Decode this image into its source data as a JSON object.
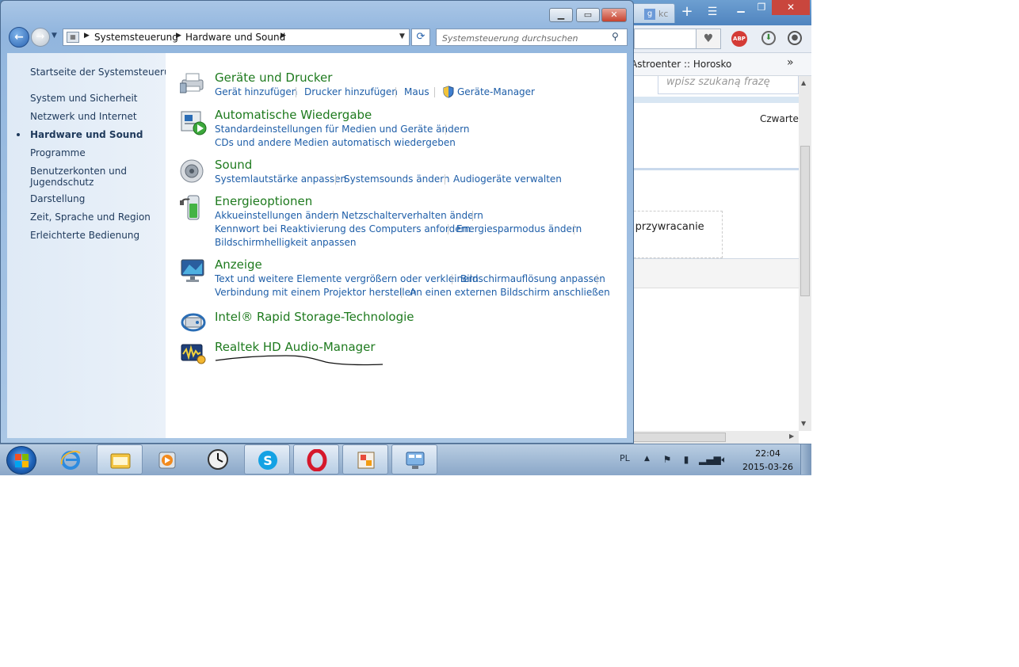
{
  "browser": {
    "tab_label": "kc",
    "new_tab": "+",
    "bookmark": "Astroenter :: Horosko",
    "search_placeholder": "wpisz szukaną frazę",
    "weekday": "Czwartek",
    "restore_text": "k przywracanie",
    "abp_label": "ABP"
  },
  "window": {
    "address_crumbs": [
      "Systemsteuerung",
      "Hardware und Sound"
    ],
    "search_placeholder": "Systemsteuerung durchsuchen"
  },
  "sidebar": {
    "items": [
      {
        "label": "Startseite der Systemsteuerung"
      },
      {
        "label": "System und Sicherheit"
      },
      {
        "label": "Netzwerk und Internet"
      },
      {
        "label": "Hardware und Sound",
        "selected": true
      },
      {
        "label": "Programme"
      },
      {
        "label": "Benutzerkonten und"
      },
      {
        "label": "Jugendschutz"
      },
      {
        "label": "Darstellung"
      },
      {
        "label": "Zeit, Sprache und Region"
      },
      {
        "label": "Erleichterte Bedienung"
      }
    ]
  },
  "categories": [
    {
      "title": "Geräte und Drucker",
      "icon": "printer-icon",
      "links": [
        "Gerät hinzufügen",
        "Drucker hinzufügen",
        "Maus",
        "Geräte-Manager"
      ]
    },
    {
      "title": "Automatische Wiedergabe",
      "icon": "autoplay-icon",
      "links": [
        "Standardeinstellungen für Medien und Geräte ändern",
        "CDs und andere Medien automatisch wiedergeben"
      ]
    },
    {
      "title": "Sound",
      "icon": "speaker-icon",
      "links": [
        "Systemlautstärke anpassen",
        "Systemsounds ändern",
        "Audiogeräte verwalten"
      ]
    },
    {
      "title": "Energieoptionen",
      "icon": "battery-icon",
      "links": [
        "Akkueinstellungen ändern",
        "Netzschalterverhalten ändern",
        "Kennwort bei Reaktivierung des Computers anfordern",
        "Energiesparmodus ändern",
        "Bildschirmhelligkeit anpassen"
      ]
    },
    {
      "title": "Anzeige",
      "icon": "monitor-icon",
      "links": [
        "Text und weitere Elemente vergrößern oder verkleinern",
        "Bildschirmauflösung anpassen",
        "Verbindung mit einem Projektor herstellen",
        "An einen externen Bildschirm anschließen"
      ]
    },
    {
      "title": "Intel® Rapid Storage-Technologie",
      "icon": "intel-storage-icon",
      "links": []
    },
    {
      "title": "Realtek HD Audio-Manager",
      "icon": "realtek-audio-icon",
      "links": []
    }
  ],
  "taskbar": {
    "apps": [
      "internet-explorer",
      "windows-explorer",
      "media-player",
      "clock",
      "skype",
      "opera",
      "paint-app",
      "control-panel"
    ],
    "active_apps": [
      "windows-explorer",
      "skype",
      "opera",
      "paint-app",
      "control-panel"
    ],
    "language": "PL",
    "time": "22:04",
    "date": "2015-03-26"
  },
  "colors": {
    "category_title": "#1e7a1e",
    "task_link": "#1e5ea8",
    "nav_text": "#1e395b",
    "close_button": "#c7432f",
    "taskbar": "#8aa7c8"
  }
}
